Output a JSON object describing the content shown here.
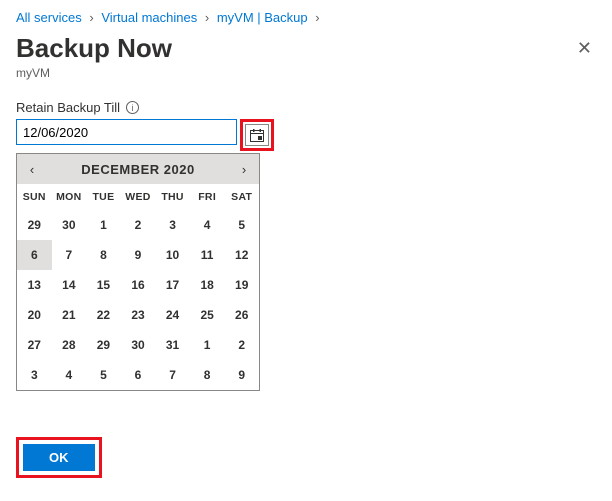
{
  "breadcrumb": {
    "items": [
      "All services",
      "Virtual machines",
      "myVM | Backup"
    ],
    "sep": "›"
  },
  "title": "Backup Now",
  "subtitle": "myVM",
  "close_glyph": "✕",
  "field": {
    "label": "Retain Backup Till",
    "info_glyph": "i",
    "value": "12/06/2020"
  },
  "calendar": {
    "prev_glyph": "‹",
    "next_glyph": "›",
    "title": "DECEMBER 2020",
    "dow": [
      "SUN",
      "MON",
      "TUE",
      "WED",
      "THU",
      "FRI",
      "SAT"
    ],
    "days": [
      {
        "n": "29",
        "other": true
      },
      {
        "n": "30",
        "other": true
      },
      {
        "n": "1"
      },
      {
        "n": "2"
      },
      {
        "n": "3"
      },
      {
        "n": "4"
      },
      {
        "n": "5"
      },
      {
        "n": "6",
        "sel": true
      },
      {
        "n": "7"
      },
      {
        "n": "8"
      },
      {
        "n": "9"
      },
      {
        "n": "10"
      },
      {
        "n": "11"
      },
      {
        "n": "12"
      },
      {
        "n": "13"
      },
      {
        "n": "14"
      },
      {
        "n": "15"
      },
      {
        "n": "16"
      },
      {
        "n": "17"
      },
      {
        "n": "18"
      },
      {
        "n": "19"
      },
      {
        "n": "20"
      },
      {
        "n": "21"
      },
      {
        "n": "22"
      },
      {
        "n": "23"
      },
      {
        "n": "24"
      },
      {
        "n": "25"
      },
      {
        "n": "26"
      },
      {
        "n": "27"
      },
      {
        "n": "28"
      },
      {
        "n": "29"
      },
      {
        "n": "30"
      },
      {
        "n": "31"
      },
      {
        "n": "1",
        "other": true
      },
      {
        "n": "2",
        "other": true
      },
      {
        "n": "3",
        "other": true
      },
      {
        "n": "4",
        "other": true
      },
      {
        "n": "5",
        "other": true
      },
      {
        "n": "6",
        "other": true
      },
      {
        "n": "7",
        "other": true
      },
      {
        "n": "8",
        "other": true
      },
      {
        "n": "9",
        "other": true
      }
    ]
  },
  "ok_label": "OK"
}
